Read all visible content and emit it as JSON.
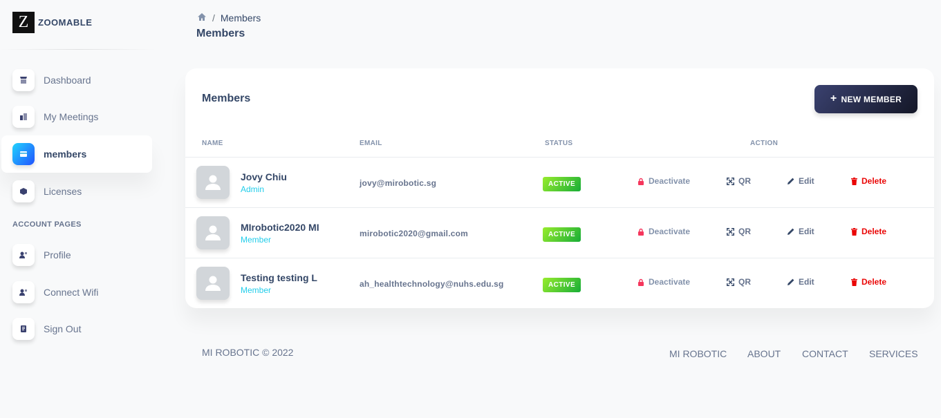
{
  "brand": {
    "logo_letter": "Z",
    "name": "ZOOMABLE"
  },
  "sidebar": {
    "items": [
      {
        "label": "Dashboard",
        "icon": "shop-icon"
      },
      {
        "label": "My Meetings",
        "icon": "office-icon"
      },
      {
        "label": "members",
        "icon": "credit-card-icon",
        "active": true
      },
      {
        "label": "Licenses",
        "icon": "box-3d-icon"
      }
    ],
    "section_title": "ACCOUNT PAGES",
    "account_items": [
      {
        "label": "Profile",
        "icon": "user-icon"
      },
      {
        "label": "Connect Wifi",
        "icon": "user-icon"
      },
      {
        "label": "Sign Out",
        "icon": "document-icon"
      }
    ]
  },
  "header": {
    "breadcrumb": {
      "current": "Members"
    },
    "page_title": "Members"
  },
  "card": {
    "title": "Members",
    "new_button": {
      "icon": "+",
      "label": "NEW MEMBER"
    },
    "columns": {
      "name": "NAME",
      "email": "EMAIL",
      "status": "STATUS",
      "action": "ACTION"
    },
    "rows": [
      {
        "name": "Jovy Chiu",
        "role": "Admin",
        "email": "jovy@mirobotic.sg",
        "status": "ACTIVE"
      },
      {
        "name": "MIrobotic2020 MI",
        "role": "Member",
        "email": "mirobotic2020@gmail.com",
        "status": "ACTIVE"
      },
      {
        "name": "Testing testing L",
        "role": "Member",
        "email": "ah_healthtechnology@nuhs.edu.sg",
        "status": "ACTIVE"
      }
    ],
    "actions": {
      "deactivate": "Deactivate",
      "qr": "QR",
      "edit": "Edit",
      "delete": "Delete"
    }
  },
  "footer": {
    "copyright": "MI ROBOTIC © 2022",
    "links": [
      "MI ROBOTIC",
      "ABOUT",
      "CONTACT",
      "SERVICES"
    ]
  },
  "colors": {
    "accent": "#21d4fd",
    "active_badge": "#17ad37",
    "delete": "#ea0606",
    "deactivate_icon": "#f5365c",
    "button_dark": "#141727"
  }
}
